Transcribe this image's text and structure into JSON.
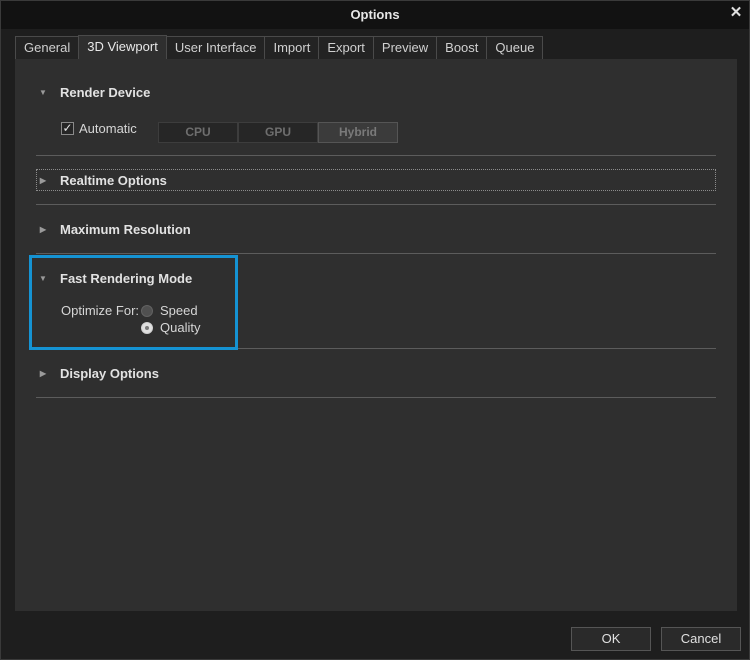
{
  "window": {
    "title": "Options",
    "close_glyph": "✕"
  },
  "tabs": [
    {
      "label": "General",
      "active": false
    },
    {
      "label": "3D Viewport",
      "active": true
    },
    {
      "label": "User Interface",
      "active": false
    },
    {
      "label": "Import",
      "active": false
    },
    {
      "label": "Export",
      "active": false
    },
    {
      "label": "Preview",
      "active": false
    },
    {
      "label": "Boost",
      "active": false
    },
    {
      "label": "Queue",
      "active": false
    }
  ],
  "sections": {
    "render_device": {
      "title": "Render Device",
      "expanded": true,
      "automatic_label": "Automatic",
      "automatic_checked": true,
      "devices": [
        "CPU",
        "GPU",
        "Hybrid"
      ],
      "selected_device": "Hybrid"
    },
    "realtime_options": {
      "title": "Realtime Options",
      "expanded": false
    },
    "maximum_resolution": {
      "title": "Maximum Resolution",
      "expanded": false
    },
    "fast_rendering_mode": {
      "title": "Fast Rendering Mode",
      "expanded": true,
      "optimize_label": "Optimize For:",
      "options": [
        "Speed",
        "Quality"
      ],
      "selected": "Quality"
    },
    "display_options": {
      "title": "Display Options",
      "expanded": false
    }
  },
  "footer": {
    "ok_label": "OK",
    "cancel_label": "Cancel"
  },
  "colors": {
    "highlight": "#1593d3",
    "panel": "#2f2f2f",
    "titlebar": "#121212"
  },
  "icons": {
    "expanded": "triangle-down-icon",
    "collapsed": "triangle-right-icon",
    "check": "checkmark-icon",
    "close": "close-icon"
  }
}
